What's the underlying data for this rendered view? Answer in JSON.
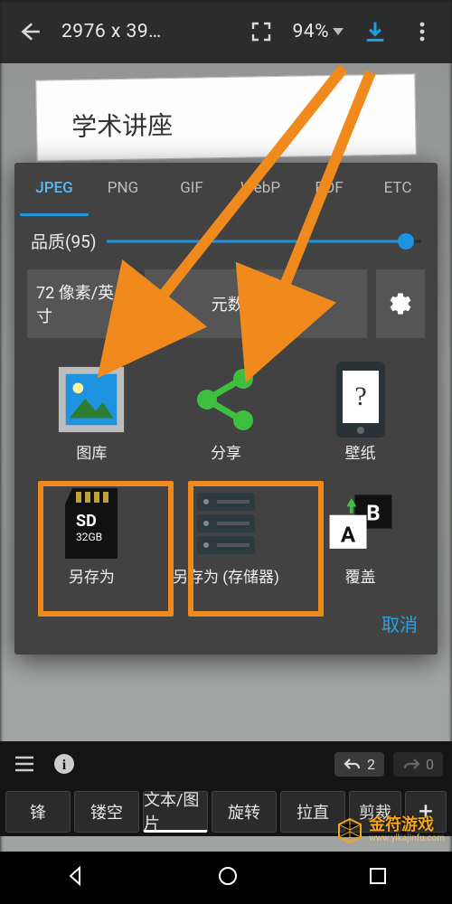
{
  "topbar": {
    "dimensions": "2976 x 39…",
    "zoom": "94%"
  },
  "bg_text": "学术讲座",
  "dialog": {
    "tabs": [
      "JPEG",
      "PNG",
      "GIF",
      "WebP",
      "PDF",
      "ETC"
    ],
    "active_tab": 0,
    "quality_label": "品质(95)",
    "quality_value": 95,
    "dpi_label": "72 像素/英寸",
    "metadata_label": "元数据: 移除",
    "actions": {
      "gallery": "图库",
      "share": "分享",
      "wallpaper": "壁纸",
      "save_as": "另存为",
      "save_storage": "另存为 (存储器)",
      "overwrite": "覆盖"
    },
    "sd_capacity": "32GB",
    "sd_label": "SD",
    "cancel": "取消"
  },
  "bottom": {
    "undo_count": "2",
    "redo_count": "0",
    "tools": [
      "锋",
      "镂空",
      "文本/图片",
      "旋转",
      "拉直",
      "剪裁"
    ]
  },
  "watermark": {
    "name": "金符游戏",
    "url": "www.yikajinfu.com"
  }
}
